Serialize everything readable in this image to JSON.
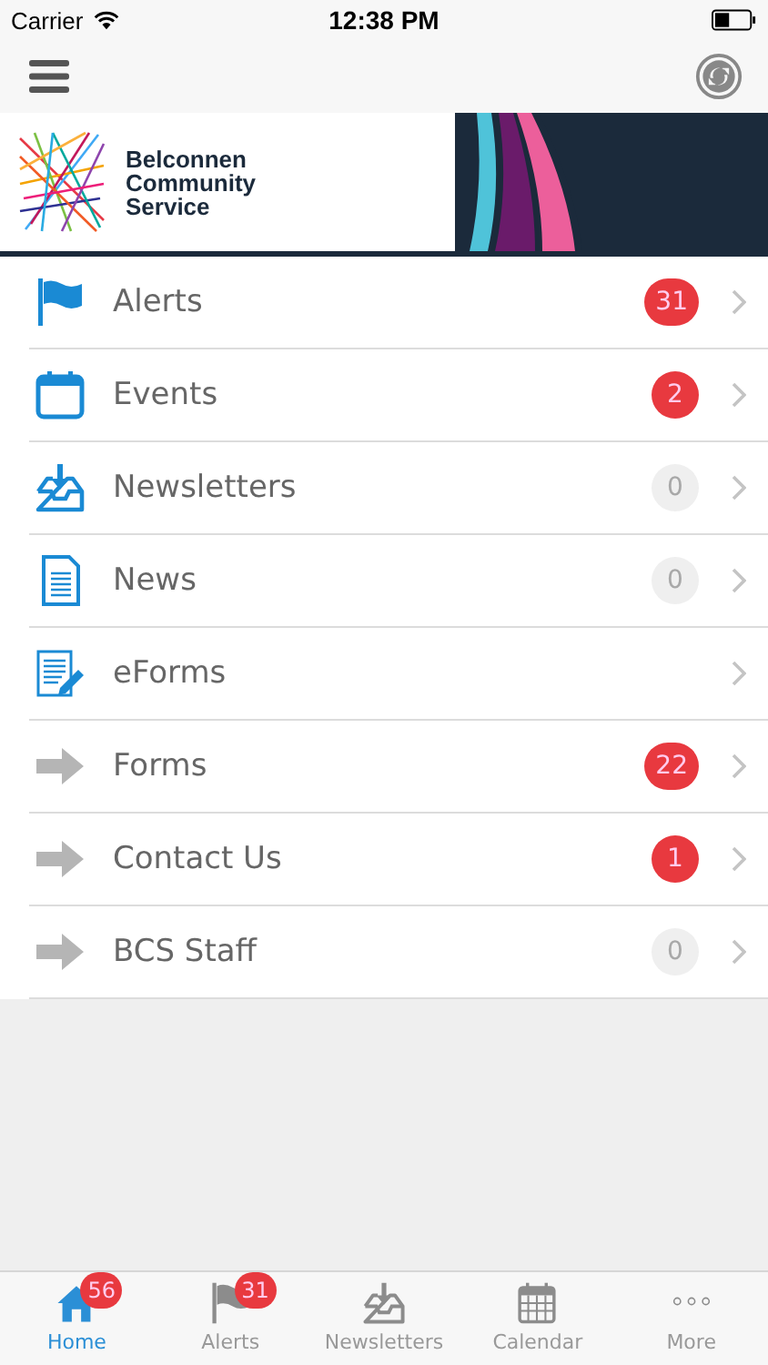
{
  "status_bar": {
    "carrier": "Carrier",
    "time": "12:38 PM"
  },
  "banner": {
    "lines": [
      "Belconnen",
      "Community",
      "Service"
    ]
  },
  "menu": [
    {
      "kind": "flag",
      "label": "Alerts",
      "badge": "31",
      "highlighted": true
    },
    {
      "kind": "calendar",
      "label": "Events",
      "badge": "2",
      "highlighted": true
    },
    {
      "kind": "inbox",
      "label": "Newsletters",
      "badge": "0",
      "highlighted": false
    },
    {
      "kind": "document",
      "label": "News",
      "badge": "0",
      "highlighted": false
    },
    {
      "kind": "form",
      "label": "eForms"
    },
    {
      "kind": "arrow",
      "label": "Forms",
      "badge": "22",
      "highlighted": true
    },
    {
      "kind": "arrow",
      "label": "Contact Us",
      "badge": "1",
      "highlighted": true
    },
    {
      "kind": "arrow",
      "label": "BCS Staff",
      "badge": "0",
      "highlighted": false
    }
  ],
  "tab_bar": [
    {
      "kind": "home",
      "label": "Home",
      "badge": "56",
      "selected": true
    },
    {
      "kind": "flag",
      "label": "Alerts",
      "badge": "31",
      "selected": false
    },
    {
      "kind": "inbox",
      "label": "Newsletters",
      "selected": false
    },
    {
      "kind": "calendar",
      "label": "Calendar",
      "selected": false
    },
    {
      "kind": "more",
      "label": "More",
      "selected": false
    }
  ]
}
